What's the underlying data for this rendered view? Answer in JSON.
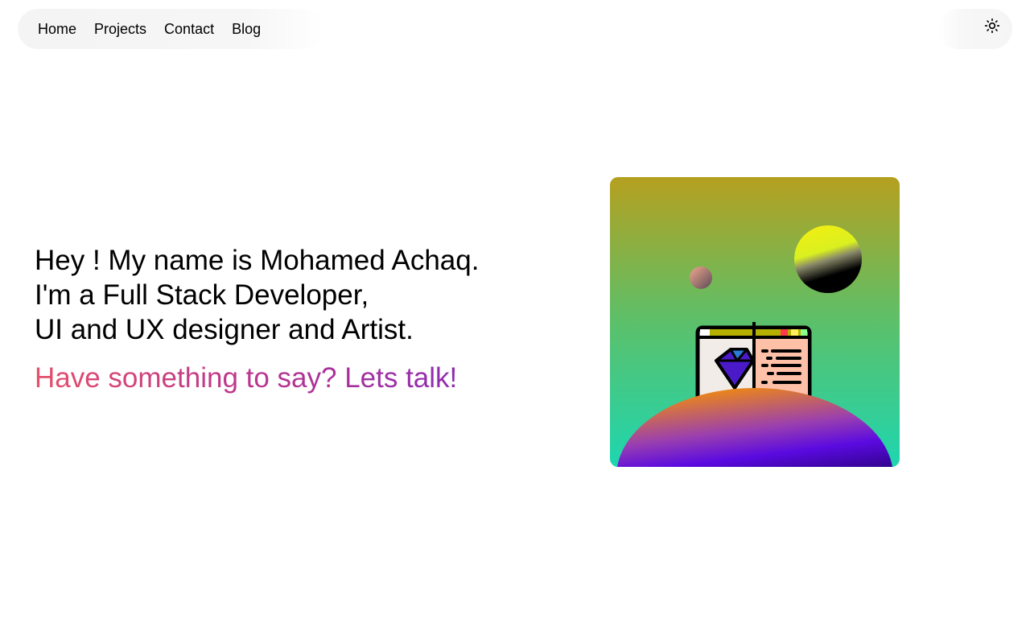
{
  "nav": {
    "items": [
      {
        "label": "Home"
      },
      {
        "label": "Projects"
      },
      {
        "label": "Contact"
      },
      {
        "label": "Blog"
      }
    ]
  },
  "header": {
    "theme_toggle_icon": "sun-icon"
  },
  "hero": {
    "lines": [
      "Hey ! My name is Mohamed Achaq.",
      "I'm a Full Stack Developer,",
      "UI and UX designer and Artist."
    ],
    "cta": "Have something to say? Lets talk!",
    "cta_gradient": [
      "#e4506a",
      "#c0378a",
      "#8f2cb0"
    ]
  },
  "artwork": {
    "background_gradient": [
      "#b5a01f",
      "#5cc06a",
      "#1ed6b0"
    ],
    "icon": "browser-window-illustration"
  }
}
